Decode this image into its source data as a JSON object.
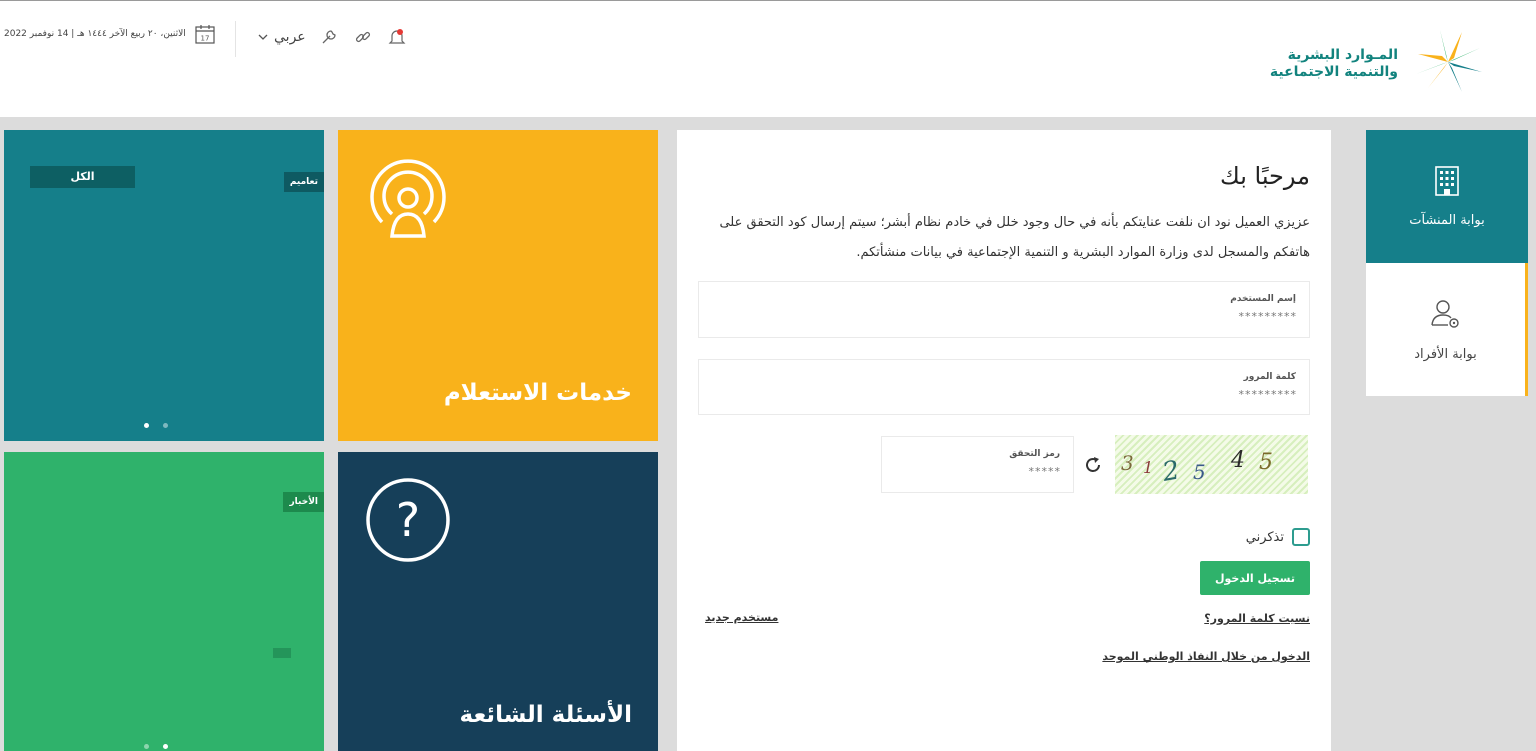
{
  "header": {
    "date_text": "الاثنين، ٢٠ ربيع الآخر ١٤٤٤ هـ | 14 نوفمبر 2022",
    "calendar_number": "17",
    "language_label": "عربي",
    "logo_line1": "المـوارد البشرية",
    "logo_line2": "والتنمية الاجتماعية"
  },
  "tiles": {
    "teal": {
      "filter_label": "الكل",
      "tag_label": "تعاميم"
    },
    "inquiry": {
      "title": "خدمات الاستعلام"
    },
    "news": {
      "tag_label": "الأخبار"
    },
    "faq": {
      "title": "الأسئلة الشائعة",
      "icon_glyph": "?"
    }
  },
  "login": {
    "welcome": "مرحبًا بك",
    "intro": "عزيزي العميل نود ان نلفت عنايتكم بأنه في حال وجود خلل في خادم نظام أبشر؛ سيتم إرسال كود التحقق على هاتفكم والمسجل لدى وزارة الموارد البشرية و التنمية الإجتماعية في بيانات منشأتكم.",
    "username_label": "إسم المستخدم",
    "username_placeholder": "*********",
    "password_label": "كلمة المرور",
    "password_placeholder": "*********",
    "captcha_label": "رمز التحقق",
    "captcha_placeholder": "*****",
    "captcha_chars": [
      "3",
      "1",
      "2",
      "5",
      "4",
      "5"
    ],
    "remember_label": "تذكرني",
    "login_button": "تسجيل الدخول",
    "forgot_link": "نسيت كلمة المرور؟",
    "new_user_link": "مستخدم جديد",
    "nafath_link": "الدخول من خلال النفاذ الوطني الموحد"
  },
  "side_tabs": {
    "establishments": "بوابة المنشآت",
    "individuals": "بوابة الأفراد"
  },
  "colors": {
    "teal": "#157f8a",
    "yellow": "#f9b21b",
    "green": "#2fb26b",
    "navy": "#163f59"
  }
}
